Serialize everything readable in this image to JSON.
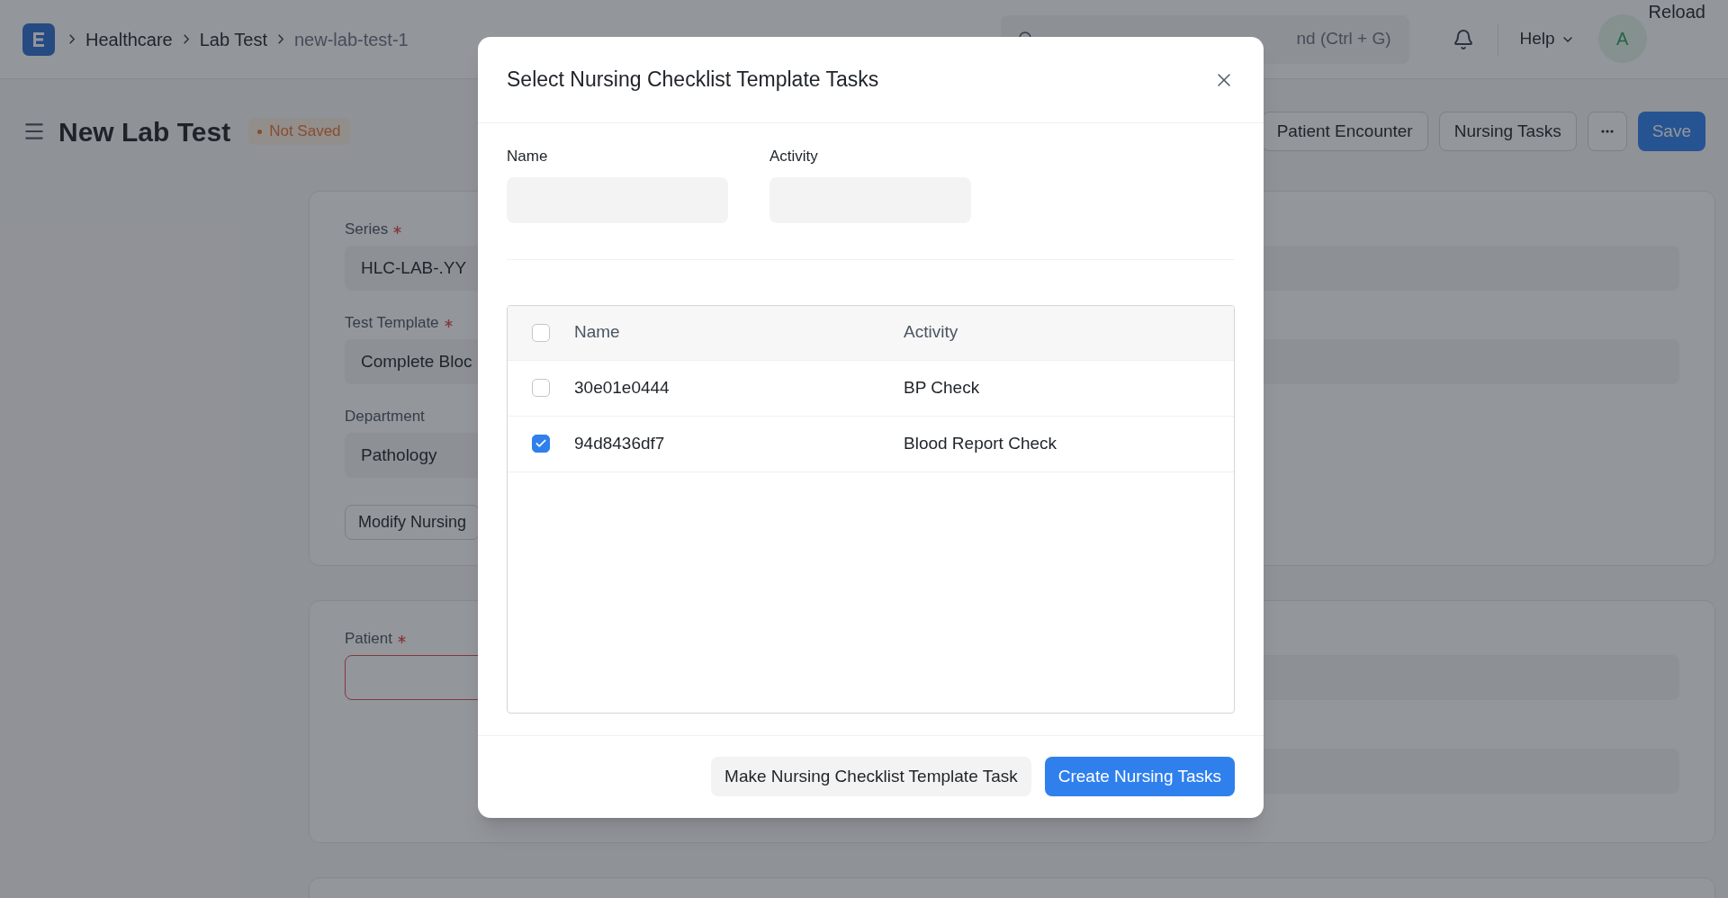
{
  "navbar": {
    "breadcrumbs": [
      "Healthcare",
      "Lab Test",
      "new-lab-test-1"
    ],
    "search": {
      "placeholder": "nd (Ctrl + G)"
    },
    "help": "Help",
    "avatar": "A",
    "reload": "Reload"
  },
  "page_header": {
    "title": "New Lab Test",
    "status": "Not Saved",
    "buttons": [
      {
        "label": "Patient Encounter",
        "kind": "default"
      },
      {
        "label": "Nursing Tasks",
        "kind": "default"
      },
      {
        "kind": "more"
      },
      {
        "label": "Save",
        "kind": "primary"
      }
    ]
  },
  "form": {
    "sections": [
      {
        "left": [
          {
            "kind": "field",
            "label": "Series",
            "required": true,
            "value": "HLC-LAB-.YY"
          },
          {
            "kind": "field",
            "label": "Test Template",
            "required": true,
            "value": "Complete Bloc"
          },
          {
            "kind": "field",
            "label": "Department",
            "required": false,
            "value": "Pathology"
          },
          {
            "kind": "button",
            "label": "Modify Nursing"
          }
        ],
        "right": [
          {
            "kind": "field"
          },
          {
            "kind": "field"
          }
        ]
      },
      {
        "left": [
          {
            "kind": "field",
            "label": "Patient",
            "required": true,
            "invalid": true
          }
        ],
        "right": [
          {
            "kind": "field"
          },
          {
            "kind": "field"
          }
        ]
      }
    ]
  },
  "dialog": {
    "title": "Select Nursing Checklist Template Tasks",
    "filters": [
      {
        "label": "Name"
      },
      {
        "label": "Activity"
      }
    ],
    "table": {
      "columns": [
        "Name",
        "Activity"
      ],
      "all_checked": false,
      "rows": [
        {
          "name": "30e01e0444",
          "activity": "BP Check",
          "checked": false
        },
        {
          "name": "94d8436df7",
          "activity": "Blood Report Check",
          "checked": true
        }
      ]
    },
    "buttons": [
      {
        "label": "Make Nursing Checklist Template Task",
        "kind": "secondary"
      },
      {
        "label": "Create Nursing Tasks",
        "kind": "primary"
      }
    ]
  }
}
